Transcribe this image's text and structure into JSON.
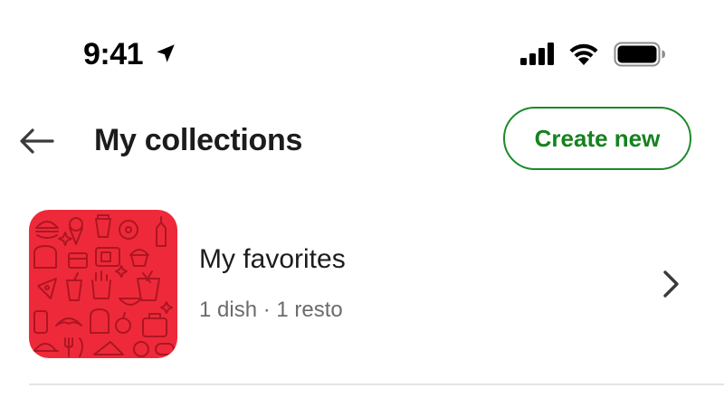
{
  "status_bar": {
    "time": "9:41"
  },
  "header": {
    "title": "My collections",
    "create_button_label": "Create new"
  },
  "collections": [
    {
      "name": "My favorites",
      "meta": "1 dish · 1 resto",
      "thumb_color": "#ee2a3a"
    }
  ],
  "colors": {
    "accent_green": "#16821f",
    "thumb_red": "#ee2a3a",
    "meta_gray": "#6b6b6b"
  },
  "icons": {
    "back": "arrow-left-icon",
    "chevron": "chevron-right-icon",
    "location": "location-arrow-icon",
    "signal": "cellular-signal-icon",
    "wifi": "wifi-icon",
    "battery": "battery-icon"
  }
}
